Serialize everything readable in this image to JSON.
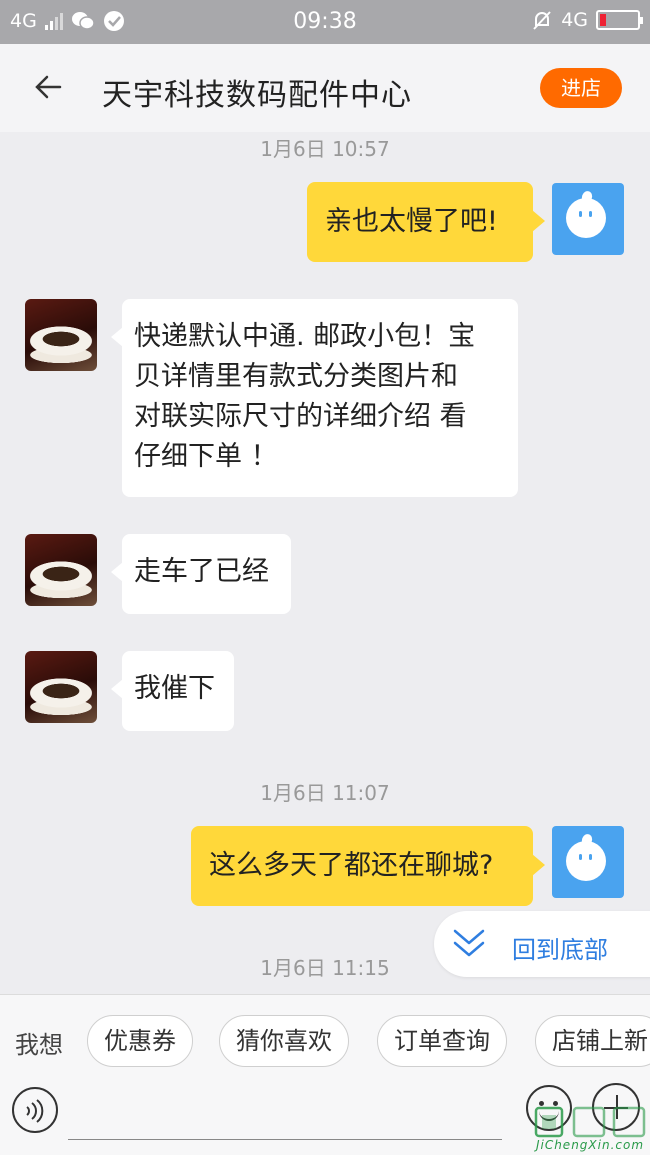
{
  "status_bar": {
    "network_left": "4G",
    "time": "09:38",
    "network_right": "4G"
  },
  "header": {
    "title": "天宇科技数码配件中心",
    "enter_shop": "进店"
  },
  "chat": {
    "timestamps": [
      "1月6日 10:57",
      "1月6日 11:07",
      "1月6日 11:15"
    ],
    "messages": [
      {
        "from": "me",
        "text": "亲也太慢了吧!"
      },
      {
        "from": "shop",
        "lines": [
          "快递默认中通. 邮政小包！宝",
          "贝详情里有款式分类图片和",
          "对联实际尺寸的详细介绍  看",
          "仔细下单 ！"
        ]
      },
      {
        "from": "shop",
        "text": "走车了已经"
      },
      {
        "from": "shop",
        "text": "我催下"
      },
      {
        "from": "me",
        "text": "这么多天了都还在聊城?"
      }
    ]
  },
  "back_to_bottom": "回到底部",
  "quick_bar": {
    "label": "我想",
    "chips": [
      "优惠券",
      "猜你喜欢",
      "订单查询",
      "店铺上新"
    ]
  },
  "watermark": {
    "text": "JiChengXin.com"
  },
  "colors": {
    "accent_orange": "#ff6a00",
    "my_bubble": "#ffd83a",
    "link_blue": "#2f7ee0",
    "my_avatar": "#4aa3ef"
  }
}
